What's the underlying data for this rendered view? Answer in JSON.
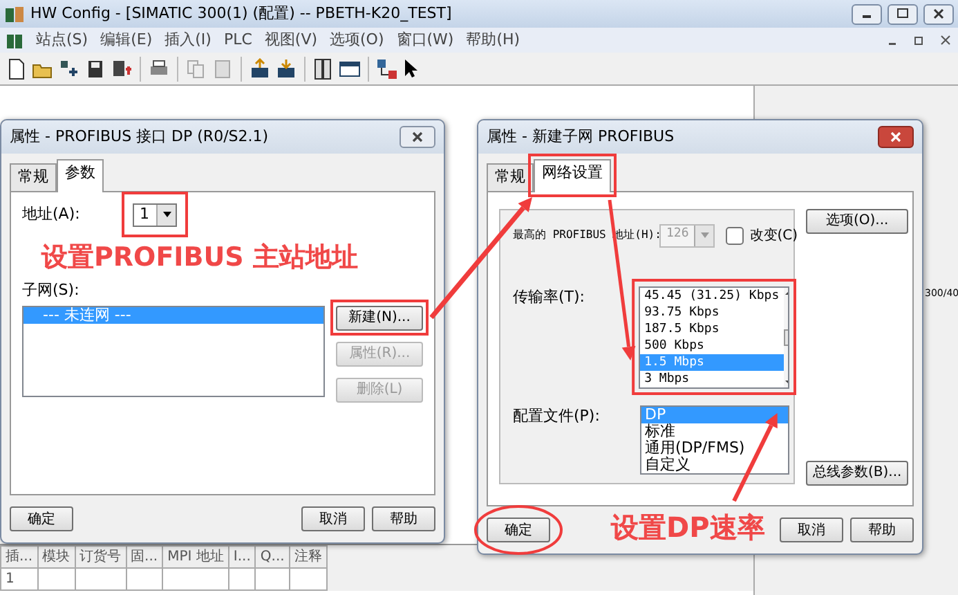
{
  "window": {
    "title": "HW Config - [SIMATIC 300(1) (配置) -- PBETH-K20_TEST]"
  },
  "menu": [
    "站点(S)",
    "编辑(E)",
    "插入(I)",
    "PLC",
    "视图(V)",
    "选项(O)",
    "窗口(W)",
    "帮助(H)"
  ],
  "side_text": "300/40",
  "dialogs": [
    {
      "title": "属性 - PROFIBUS 接口  DP (R0/S2.1)",
      "tabs": [
        {
          "label": "常规",
          "selected": false
        },
        {
          "label": "参数",
          "selected": true
        }
      ],
      "address": {
        "label": "地址(A):",
        "value": "1"
      },
      "subnet": {
        "label": "子网(S):",
        "items": [
          {
            "label": "--- 未连网 ---",
            "selected": true
          }
        ]
      },
      "side_buttons": [
        {
          "label": "新建(N)...",
          "disabled": false
        },
        {
          "label": "属性(R)...",
          "disabled": true
        },
        {
          "label": "删除(L)",
          "disabled": true
        }
      ],
      "footer": [
        "确定",
        "取消",
        "帮助"
      ]
    },
    {
      "title": "属性 - 新建子网 PROFIBUS",
      "tabs": [
        {
          "label": "常规",
          "selected": false
        },
        {
          "label": "网络设置",
          "selected": true
        }
      ],
      "highest_address": {
        "label": "最高的 PROFIBUS 地址(H):",
        "value": "126",
        "disabled": true
      },
      "change_checkbox": {
        "label": "改变(C)",
        "checked": false
      },
      "transmission_rate": {
        "label": "传输率(T):",
        "items": [
          {
            "label": "45.45 (31.25) Kbps",
            "selected": false
          },
          {
            "label": "93.75 Kbps",
            "selected": false
          },
          {
            "label": "187.5 Kbps",
            "selected": false
          },
          {
            "label": "500 Kbps",
            "selected": false
          },
          {
            "label": "1.5 Mbps",
            "selected": true
          },
          {
            "label": "3 Mbps",
            "selected": false
          }
        ]
      },
      "profile": {
        "label": "配置文件(P):",
        "items": [
          {
            "label": "DP",
            "selected": true
          },
          {
            "label": "标准",
            "selected": false
          },
          {
            "label": "通用(DP/FMS)",
            "selected": false
          },
          {
            "label": "自定义",
            "selected": false
          }
        ]
      },
      "side_buttons": [
        {
          "label": "选项(O)...",
          "disabled": false
        },
        {
          "label": "总线参数(B)...",
          "disabled": false
        }
      ],
      "footer": [
        "确定",
        "取消",
        "帮助"
      ]
    }
  ],
  "annotations": [
    "设置PROFIBUS 主站地址",
    "设置DP速率"
  ],
  "table": {
    "columns": [
      "插...",
      "模块",
      "订货号",
      "固...",
      "MPI 地址",
      "I...",
      "Q...",
      "注释"
    ],
    "rows": [
      [
        "1",
        "",
        "",
        "",
        "",
        "",
        "",
        ""
      ]
    ]
  }
}
